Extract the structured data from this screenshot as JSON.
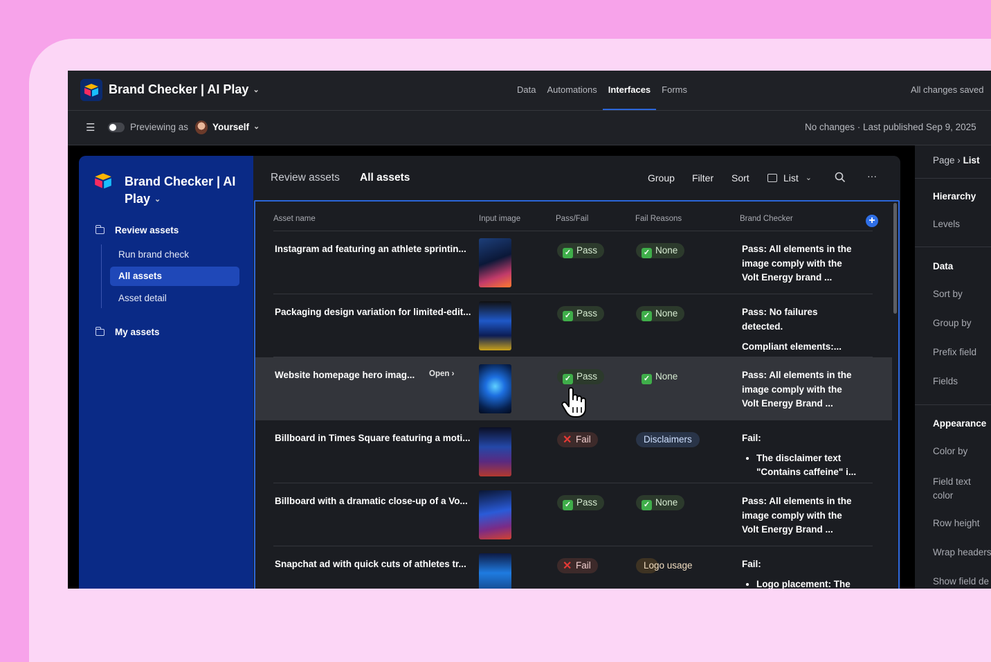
{
  "app": {
    "title": "Brand Checker | AI Play",
    "nav": [
      "Data",
      "Automations",
      "Interfaces",
      "Forms"
    ],
    "active_nav": "Interfaces",
    "save_status": "All changes saved"
  },
  "preview_bar": {
    "previewing_label": "Previewing as",
    "user": "Yourself",
    "publish_status": "No changes · Last published Sep 9, 2025"
  },
  "sidebar": {
    "title": "Brand Checker | AI Play",
    "sections": [
      {
        "label": "Review assets",
        "items": [
          "Run brand check",
          "All assets",
          "Asset detail"
        ]
      },
      {
        "label": "My assets",
        "items": []
      }
    ],
    "active_item": "All assets"
  },
  "main": {
    "breadcrumb": [
      "Review assets",
      "All assets"
    ],
    "toolbar": {
      "group": "Group",
      "filter": "Filter",
      "sort": "Sort",
      "view": "List",
      "more": "···"
    },
    "columns": [
      "Asset name",
      "Input image",
      "Pass/Fail",
      "Fail Reasons",
      "Brand Checker"
    ],
    "open_label": "Open",
    "rows": [
      {
        "name": "Instagram ad featuring an athlete sprintin...",
        "status": "Pass",
        "reason": "None",
        "brand": "Pass: All elements in the image comply with the Volt Energy brand ...",
        "brand_extra": "",
        "bullet": ""
      },
      {
        "name": "Packaging design variation for limited-edit...",
        "status": "Pass",
        "reason": "None",
        "brand": "Pass: No failures detected.",
        "brand_extra": "Compliant elements:...",
        "bullet": ""
      },
      {
        "name": "Website homepage hero imag...",
        "status": "Pass",
        "reason": "None",
        "brand": "Pass: All elements in the image comply with the Volt Energy Brand ...",
        "brand_extra": "",
        "bullet": ""
      },
      {
        "name": "Billboard in Times Square featuring a moti...",
        "status": "Fail",
        "reason": "Disclaimers",
        "brand": "Fail:",
        "brand_extra": "",
        "bullet": "The disclaimer text \"Contains caffeine\" i..."
      },
      {
        "name": "Billboard with a dramatic close-up of a Vo...",
        "status": "Pass",
        "reason": "None",
        "brand": "Pass: All elements in the image comply with the Volt Energy Brand ...",
        "brand_extra": "",
        "bullet": ""
      },
      {
        "name": "Snapchat ad with quick cuts of athletes tr...",
        "status": "Fail",
        "reason": "Logo usage",
        "brand": "Fail:",
        "brand_extra": "",
        "bullet": "Logo placement: The"
      }
    ]
  },
  "right_panel": {
    "breadcrumb_page": "Page",
    "breadcrumb_current": "List",
    "items": [
      {
        "text": "Hierarchy",
        "kind": "heading"
      },
      {
        "text": "Levels",
        "kind": "item"
      },
      {
        "text": "Data",
        "kind": "heading"
      },
      {
        "text": "Sort by",
        "kind": "item"
      },
      {
        "text": "Group by",
        "kind": "item"
      },
      {
        "text": "Prefix field",
        "kind": "item"
      },
      {
        "text": "Fields",
        "kind": "item"
      },
      {
        "text": "Appearance",
        "kind": "heading"
      },
      {
        "text": "Color by",
        "kind": "item"
      },
      {
        "text": "Field text color",
        "kind": "item"
      },
      {
        "text": "Row height",
        "kind": "item"
      },
      {
        "text": "Wrap headers",
        "kind": "item"
      },
      {
        "text": "Show field de",
        "kind": "item"
      }
    ]
  },
  "colors": {
    "background": "#f7a3ea",
    "sidebar": "#0a2a86",
    "accent": "#2b66d9",
    "pass": "#3fae4a",
    "fail": "#e53935"
  }
}
